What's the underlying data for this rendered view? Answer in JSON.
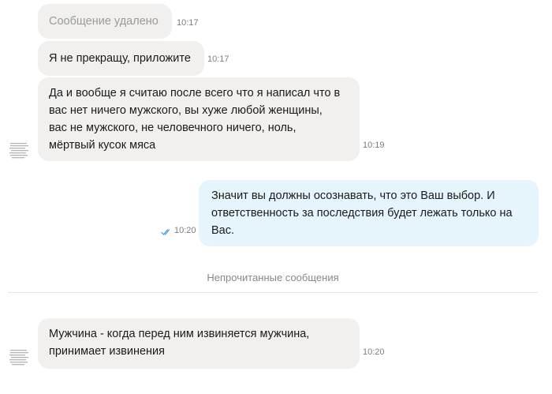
{
  "messages": [
    {
      "text": "Сообщение удалено",
      "time": "10:17",
      "deleted": true
    },
    {
      "text": "Я не прекращу, приложите",
      "time": "10:17"
    },
    {
      "lines": [
        "Да и вообще я считаю после всего что я написал что в",
        "вас нет ничего мужского, вы хуже любой женщины,",
        "вас не мужского, не человечного ничего,  ноль,",
        "мёртвый кусок мяса"
      ],
      "time": "10:19",
      "avatar": "avatar-icon"
    },
    {
      "lines": [
        "Значит вы должны осознавать, что это Ваш выбор. И",
        "ответственность за последствия будет лежать только на",
        "Вас."
      ],
      "time": "10:20",
      "status": "double-check-icon"
    },
    {
      "lines": [
        "Мужчина - когда перед ним извиняется мужчина,",
        "принимает извинения"
      ],
      "time": "10:20",
      "avatar": "avatar-icon"
    }
  ],
  "unread_divider": "Непрочитанные сообщения",
  "colors": {
    "incoming_bubble": "#f1f0ef",
    "outgoing_bubble": "#e6f4fc",
    "read_check": "#4aa3df"
  }
}
